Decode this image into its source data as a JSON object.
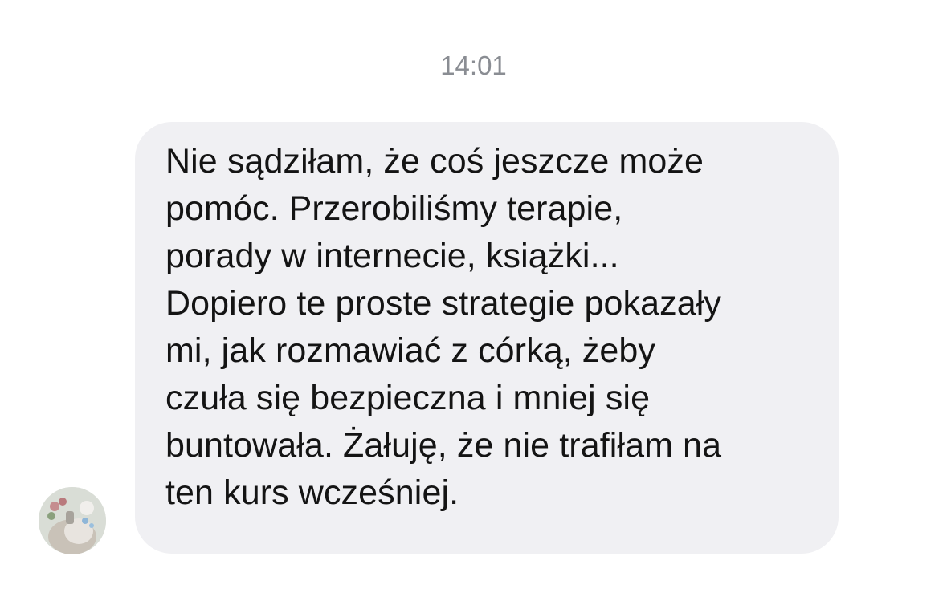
{
  "header": {
    "time": "14:01"
  },
  "message": {
    "direction": "incoming",
    "text": "Nie sądziłam, że coś jeszcze może\npomóc. Przerobiliśmy terapie,\nporady w internecie, książki...\nDopiero te proste strategie pokazały\nmi, jak rozmawiać z córką, żeby\nczuła się bezpieczna i mniej się\nbuntowała. Żałuję, że nie trafiłam na\nten kurs wcześniej."
  },
  "sender": {
    "avatar": "profile-photo-icon"
  },
  "colors": {
    "background": "#ffffff",
    "bubble": "#f0f0f3",
    "text": "#141414",
    "timestamp": "#8a8d93"
  }
}
